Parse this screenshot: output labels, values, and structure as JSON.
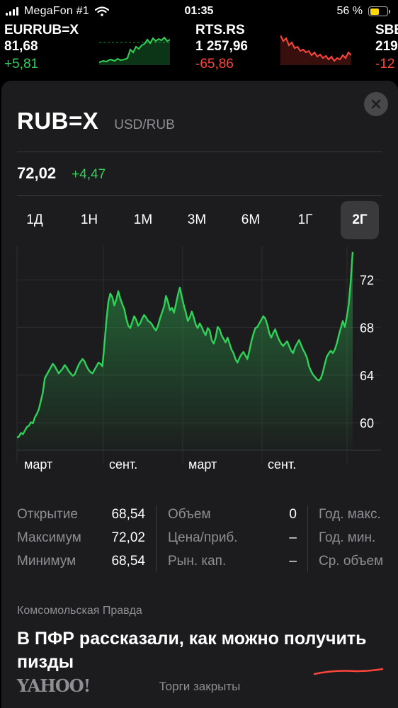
{
  "status_bar": {
    "carrier": "MegaFon #1",
    "time": "01:35",
    "battery": "56 %",
    "battery_level": 0.56,
    "battery_color": "#ffd60a"
  },
  "tickers": [
    {
      "symbol": "EURRUB=X",
      "price": "81,68",
      "change": "+5,81",
      "direction": "up"
    },
    {
      "symbol": "RTS.RS",
      "price": "1 257,96",
      "change": "-65,86",
      "direction": "down"
    },
    {
      "symbol": "SBE",
      "price": "219",
      "change": "-12",
      "direction": "down"
    }
  ],
  "detail": {
    "symbol": "RUB=X",
    "pair": "USD/RUB",
    "price": "72,02",
    "change": "+4,47",
    "close_icon": "close-icon",
    "ranges": [
      "1Д",
      "1Н",
      "1М",
      "3М",
      "6М",
      "1Г",
      "2Г"
    ],
    "active_range": "2Г"
  },
  "chart_data": {
    "type": "area",
    "x_labels": [
      "март",
      "сент.",
      "март",
      "сент."
    ],
    "y_ticks": [
      "72",
      "68",
      "64",
      "60"
    ],
    "ylim": [
      56.5,
      73.5
    ],
    "values": [
      57.2,
      57.3,
      57.6,
      57.5,
      57.8,
      58.1,
      58.2,
      58.5,
      58.4,
      58.9,
      59.2,
      59.6,
      60.3,
      61.0,
      62.2,
      62.5,
      62.8,
      63.1,
      63.4,
      63.2,
      62.9,
      62.6,
      62.8,
      63.0,
      63.3,
      63.1,
      62.8,
      62.6,
      62.4,
      62.5,
      62.9,
      63.3,
      63.6,
      63.8,
      63.6,
      63.2,
      62.9,
      62.7,
      62.6,
      62.9,
      63.2,
      63.5,
      63.4,
      63.2,
      65.0,
      67.0,
      68.6,
      69.3,
      69.0,
      68.3,
      68.8,
      69.5,
      68.9,
      68.4,
      68.0,
      67.2,
      66.6,
      66.4,
      66.9,
      67.4,
      67.1,
      66.6,
      66.8,
      67.2,
      67.5,
      67.3,
      67.0,
      66.9,
      66.7,
      66.4,
      66.2,
      66.6,
      67.2,
      67.7,
      68.2,
      69.1,
      68.6,
      67.9,
      68.1,
      67.7,
      68.4,
      69.2,
      69.8,
      69.0,
      68.3,
      67.7,
      67.0,
      67.3,
      67.8,
      67.3,
      66.7,
      66.4,
      66.8,
      66.5,
      66.1,
      65.8,
      66.4,
      66.2,
      65.4,
      65.1,
      65.6,
      66.5,
      66.3,
      65.8,
      65.5,
      65.2,
      65.6,
      65.1,
      64.6,
      64.3,
      63.8,
      63.5,
      63.9,
      64.2,
      64.4,
      64.1,
      63.8,
      64.5,
      65.3,
      65.9,
      66.4,
      66.5,
      66.8,
      67.1,
      67.4,
      67.2,
      66.7,
      66.0,
      65.6,
      66.0,
      66.3,
      65.8,
      65.4,
      65.1,
      64.9,
      65.1,
      65.3,
      64.9,
      64.5,
      64.3,
      64.8,
      65.1,
      65.4,
      65.0,
      64.6,
      64.3,
      63.9,
      63.2,
      62.8,
      62.5,
      62.3,
      62.1,
      62.0,
      62.2,
      62.7,
      63.4,
      64.0,
      64.3,
      64.5,
      64.3,
      64.6,
      65.1,
      65.8,
      66.4,
      67.0,
      66.5,
      67.3,
      68.4,
      70.3,
      72.8
    ],
    "grid": true
  },
  "stats": {
    "col1": [
      {
        "label": "Открытие",
        "value": "68,54"
      },
      {
        "label": "Максимум",
        "value": "72,02"
      },
      {
        "label": "Минимум",
        "value": "68,54"
      }
    ],
    "col2": [
      {
        "label": "Объем",
        "value": "0"
      },
      {
        "label": "Цена/приб.",
        "value": "–"
      },
      {
        "label": "Рын. кап.",
        "value": "–"
      }
    ],
    "col3": [
      {
        "label": "Год. макс."
      },
      {
        "label": "Год. мин."
      },
      {
        "label": "Ср. объем"
      }
    ]
  },
  "news": {
    "source": "Комсомольская Правда",
    "headline": "В ПФР рассказали, как можно получить пизды"
  },
  "footer": {
    "provider": "YAHOO!",
    "market_status": "Торги закрыты"
  },
  "colors": {
    "positive": "#30d158",
    "negative": "#ff453a",
    "card_bg": "#1c1c1e"
  }
}
